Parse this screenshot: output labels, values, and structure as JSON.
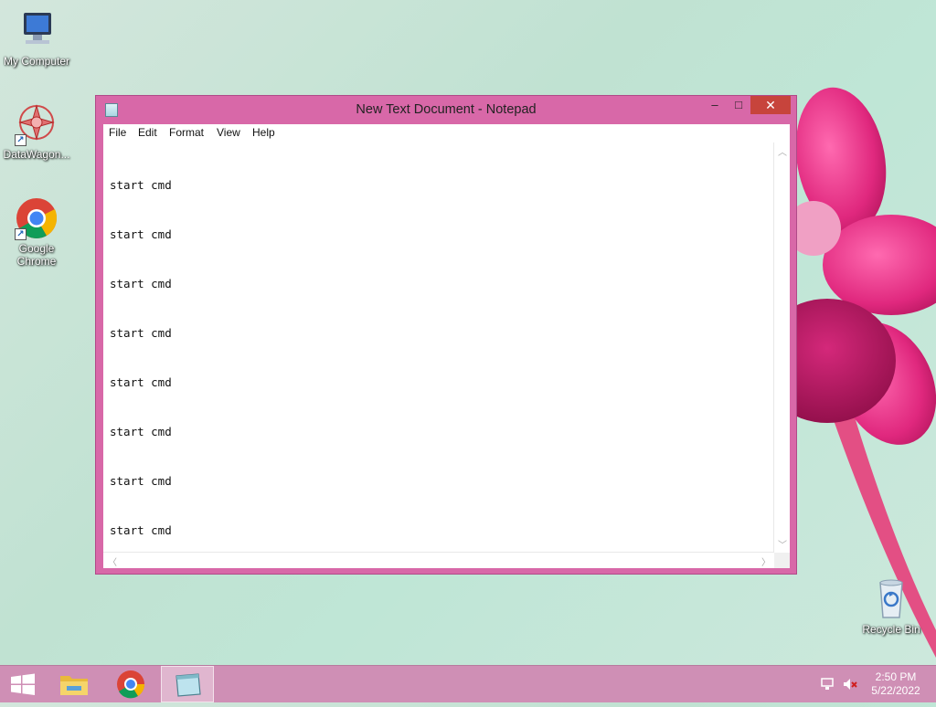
{
  "desktop": {
    "icons": [
      {
        "label": "My Computer"
      },
      {
        "label": "DataWagon..."
      },
      {
        "label": "Google Chrome"
      },
      {
        "label": "Recycle Bin"
      }
    ]
  },
  "window": {
    "title": "New Text Document - Notepad",
    "controls": {
      "minimize": "‒",
      "maximize": "□",
      "close": "✕"
    },
    "menu": [
      "File",
      "Edit",
      "Format",
      "View",
      "Help"
    ],
    "content_lines": [
      "start cmd",
      "start cmd",
      "start cmd",
      "start cmd",
      "start cmd",
      "start cmd",
      "start cmd",
      "start cmd"
    ]
  },
  "taskbar": {
    "start": "windows-logo",
    "pinned": [
      "file-explorer",
      "google-chrome",
      "notepad"
    ],
    "active": "notepad",
    "clock": {
      "time": "2:50 PM",
      "date": "5/22/2022"
    }
  },
  "colors": {
    "window_frame": "#d868a8",
    "close_button": "#c7443c",
    "taskbar": "#cf8fb5"
  }
}
